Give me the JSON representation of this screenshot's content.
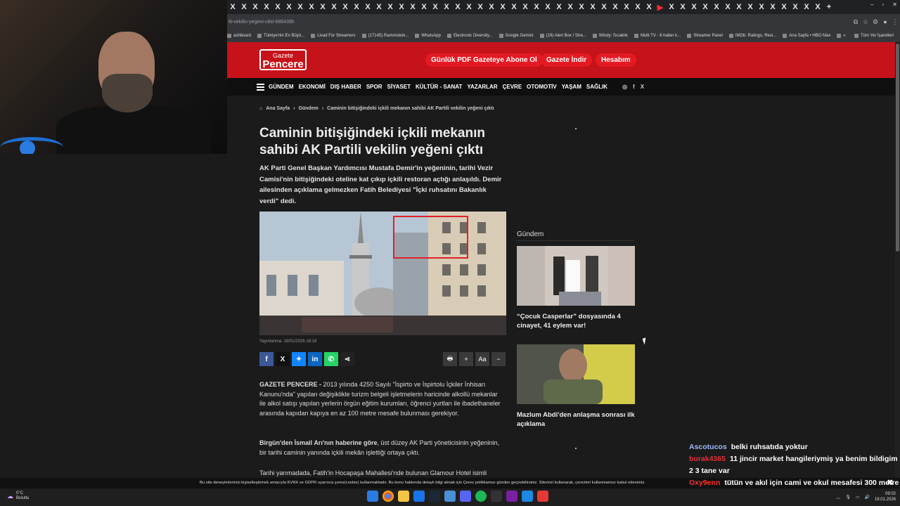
{
  "browser": {
    "tab_close_glyph": "X",
    "new_tab_glyph": "+",
    "url": "tli-vekilin-yegeni-cikti-686439h",
    "window_controls": [
      "–",
      "▫",
      "✕"
    ],
    "bookmarks": [
      "ashboard",
      "Türkiye'nin En Büyü...",
      "Livad For Streamers",
      "(17145) Rammstein...",
      "WhatsApp",
      "Electronic Diversity...",
      "Google Gemini",
      "(19) Alert Box / Stre...",
      "Windy: Sıcaklık",
      "Multi TV - 6 haber k...",
      "Streamer Panel",
      "IMDb: Ratings, Revi...",
      "Ana Sayfa • HBO Max",
      "»",
      "Tüm Yer İşaretleri"
    ]
  },
  "site": {
    "logo_top": "Gazete",
    "logo_bottom": "Pencere",
    "header_buttons": [
      "Günlük PDF Gazeteye Abone Ol",
      "Gazete İndir",
      "Hesabım"
    ],
    "nav": [
      "GÜNDEM",
      "EKONOMİ",
      "DIŞ HABER",
      "SPOR",
      "SİYASET",
      "KÜLTÜR - SANAT",
      "YAZARLAR",
      "ÇEVRE",
      "OTOMOTİV",
      "YAŞAM",
      "SAĞLIK"
    ],
    "social_icons": [
      "instagram-icon",
      "facebook-icon",
      "x-icon"
    ]
  },
  "article": {
    "breadcrumb": [
      "Ana Sayfa",
      "Gündem",
      "Caminin bitişiğindeki içkili mekanın sahibi AK Partili vekilin yeğeni çıktı"
    ],
    "title": "Caminin bitişiğindeki içkili mekanın sahibi AK Partili vekilin yeğeni çıktı",
    "summary": "AK Parti Genel Başkan Yardımcısı Mustafa Demir'in yeğeninin, tarihi Vezir Camisi'nin bitişiğindeki oteline kat çıkıp içkili restoran açtığı anlaşıldı. Demir ailesinden açıklama gelmezken Fatih Belediyesi \"İçki ruhsatını Bakanlık verdi\" dedi.",
    "published": "Yayınlanma: 18/01/2026 18:18",
    "p1_lead": "GAZETE PENCERE -",
    "p1_body": " 2013 yılında 4250 Sayılı \"İspirto ve İspirtolu İçkiler İnhisarı Kanunu'nda\" yapılan değişiklikle turizm belgeli işletmelerin haricinde alkollü mekanlar ile alkol satışı yapılan yerlerin örgün eğitim kurumları, öğrenci yurtları ile ibadethaneler arasında kapıdan kapıya en az 100 metre mesafe bulunması gerekiyor.",
    "p2_lead": "Birgün'den İsmail Arı'nın haberine göre",
    "p2_body": ", üst düzey AK Parti yöneticisinin yeğeninin, bir tarihi caminin yanında içkili mekân işlettiği ortaya çıktı.",
    "p3": "Tarihi yarımadada, Fatih'in Hocapaşa Mahallesi'nde bulunan Glamour Hotel isimli",
    "tool_labels": [
      "🖶",
      "+",
      "Aa",
      "−"
    ]
  },
  "sidebar": {
    "section": "Gündem",
    "cards": [
      {
        "title": "“Çocuk Casperlar” dosyasında 4 cinayet, 41 eylem var!"
      },
      {
        "title": "Mazlum Abdi'den anlaşma sonrası ilk açıklama"
      }
    ]
  },
  "cookie": {
    "text": "Bu site deneyimlerinizi kişiselleştirmek amacıyla KVKK ve GDPR uyarınca çerez(cookie) kullanmaktadır. Bu konu hakkında detaylı bilgi almak için Çerez politikamızı gözden geçirebilirsiniz. Sitemizi kullanarak, çerezleri kullanmamızı kabul edersiniz.",
    "close": "✖"
  },
  "chat": [
    {
      "user": "Ascotucos",
      "color": "#9db8ff",
      "text": "belki ruhsatıda yoktur"
    },
    {
      "user": "burak4365",
      "color": "#e0303a",
      "text": "11 jincir market hangileriymiş ya benim bildigim 2 3 tane var"
    },
    {
      "user": "Oxy9enn",
      "color": "#ff3030",
      "text": "tütün ve akıl için cami ve okul mesafesi 300 metre"
    }
  ],
  "taskbar": {
    "weather_temp": "0°C",
    "weather_desc": "Bulutlu",
    "time": "09:02",
    "date": "19.01.2026"
  },
  "colors": {
    "brand_red": "#c6121a",
    "facebook": "#3b5998",
    "bluesky": "#1185fe",
    "linkedin": "#0a66c2",
    "whatsapp": "#25d366"
  }
}
